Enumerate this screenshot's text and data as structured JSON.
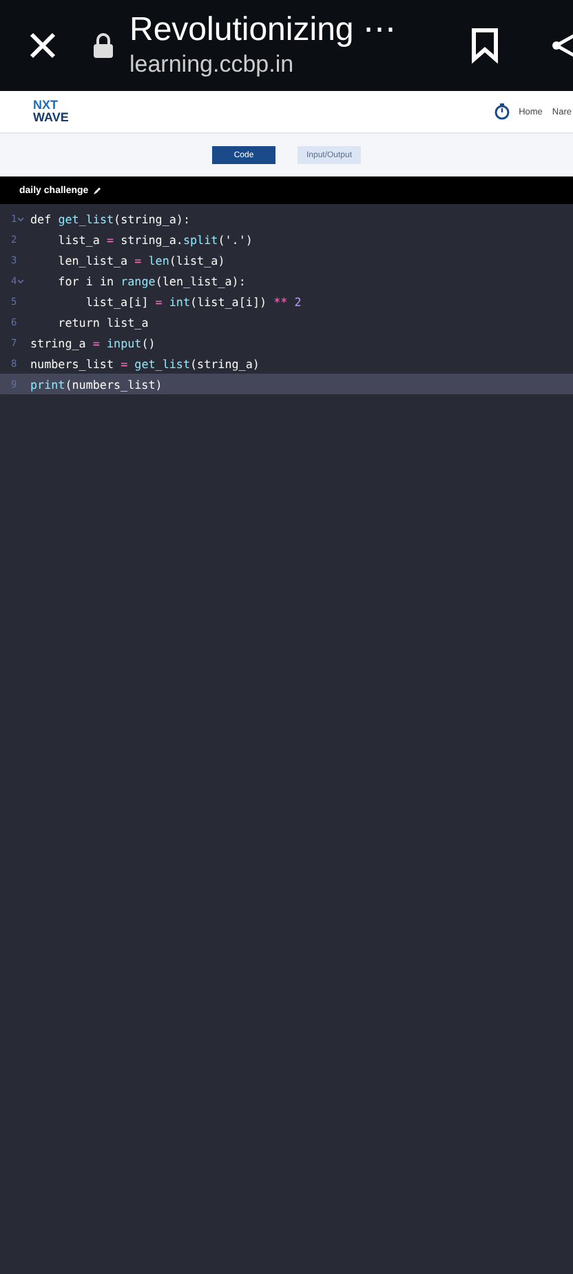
{
  "browser_bar": {
    "title": "Revolutionizing ⋯",
    "url": "learning.ccbp.in"
  },
  "header": {
    "logo_top": "NXT",
    "logo_bottom": "WAVE",
    "nav": [
      "Home",
      "Nare"
    ]
  },
  "tabs": [
    {
      "label": "Code",
      "selected": true
    },
    {
      "label": "Input/Output",
      "selected": false
    }
  ],
  "editor": {
    "title": "daily challenge",
    "lines": [
      {
        "number": "1",
        "foldable": true,
        "selected": false,
        "code": "def get_list(string_a):"
      },
      {
        "number": "2",
        "foldable": false,
        "selected": false,
        "code": "    list_a = string_a.split('.')"
      },
      {
        "number": "3",
        "foldable": false,
        "selected": false,
        "code": "    len_list_a = len(list_a)"
      },
      {
        "number": "4",
        "foldable": true,
        "selected": false,
        "code": "    for i in range(len_list_a):"
      },
      {
        "number": "5",
        "foldable": false,
        "selected": false,
        "code": "        list_a[i] = int(list_a[i]) ** 2"
      },
      {
        "number": "6",
        "foldable": false,
        "selected": false,
        "code": "    return list_a"
      },
      {
        "number": "7",
        "foldable": false,
        "selected": false,
        "code": "string_a = input()"
      },
      {
        "number": "8",
        "foldable": false,
        "selected": false,
        "code": "numbers_list = get_list(string_a)"
      },
      {
        "number": "9",
        "foldable": false,
        "selected": true,
        "code": "print(numbers_list)"
      }
    ]
  }
}
